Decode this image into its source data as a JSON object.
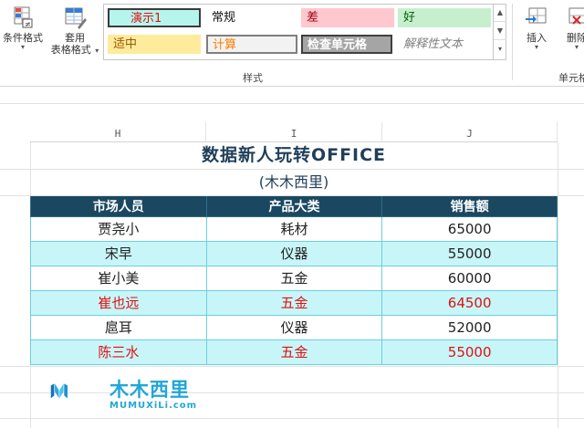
{
  "ribbon": {
    "conditional_format": {
      "label": "条件格式"
    },
    "table_format": {
      "label_line1": "套用",
      "label_line2": "表格格式"
    },
    "cell_styles": [
      {
        "label": "演示1",
        "bg": "#b6f5ec",
        "color": "#e01010",
        "border": "#3b3b3b"
      },
      {
        "label": "常规",
        "bg": "#ffffff",
        "color": "#111111",
        "border": "#ffffff"
      },
      {
        "label": "差",
        "bg": "#ffc7ce",
        "color": "#9c0006",
        "border": "#ffc7ce"
      },
      {
        "label": "好",
        "bg": "#c6efce",
        "color": "#006100",
        "border": "#c6efce"
      },
      {
        "label": "适中",
        "bg": "#ffeb9c",
        "color": "#9c5700",
        "border": "#ffeb9c"
      },
      {
        "label": "计算",
        "bg": "#f2f2f2",
        "color": "#fa7d00",
        "border": "#7f7f7f"
      },
      {
        "label": "检查单元格",
        "bg": "#a5a5a5",
        "color": "#ffffff",
        "border": "#3f3f3f"
      },
      {
        "label": "解释性文本",
        "bg": "#ffffff",
        "color": "#7f7f7f",
        "border": "#ffffff"
      }
    ],
    "styles_group": "样式",
    "insert": {
      "label": "插入"
    },
    "delete": {
      "label": "删除"
    },
    "cells_group": "单元格"
  },
  "columns": [
    "H",
    "I",
    "J"
  ],
  "sheet": {
    "title": "数据新人玩转OFFICE",
    "subtitle": "(木木西里)",
    "headers": [
      "市场人员",
      "产品大类",
      "销售额"
    ],
    "rows": [
      {
        "cells": [
          "贾尧小",
          "耗材",
          "65000"
        ],
        "highlight": false,
        "alt": false
      },
      {
        "cells": [
          "宋早",
          "仪器",
          "55000"
        ],
        "highlight": false,
        "alt": true
      },
      {
        "cells": [
          "崔小美",
          "五金",
          "60000"
        ],
        "highlight": false,
        "alt": false
      },
      {
        "cells": [
          "崔也远",
          "五金",
          "64500"
        ],
        "highlight": true,
        "alt": true
      },
      {
        "cells": [
          "扈耳",
          "仪器",
          "52000"
        ],
        "highlight": false,
        "alt": false
      },
      {
        "cells": [
          "陈三水",
          "五金",
          "55000"
        ],
        "highlight": true,
        "alt": true
      }
    ]
  },
  "watermark": {
    "name": "木木西里",
    "site": "MUMUXiLi.com"
  }
}
